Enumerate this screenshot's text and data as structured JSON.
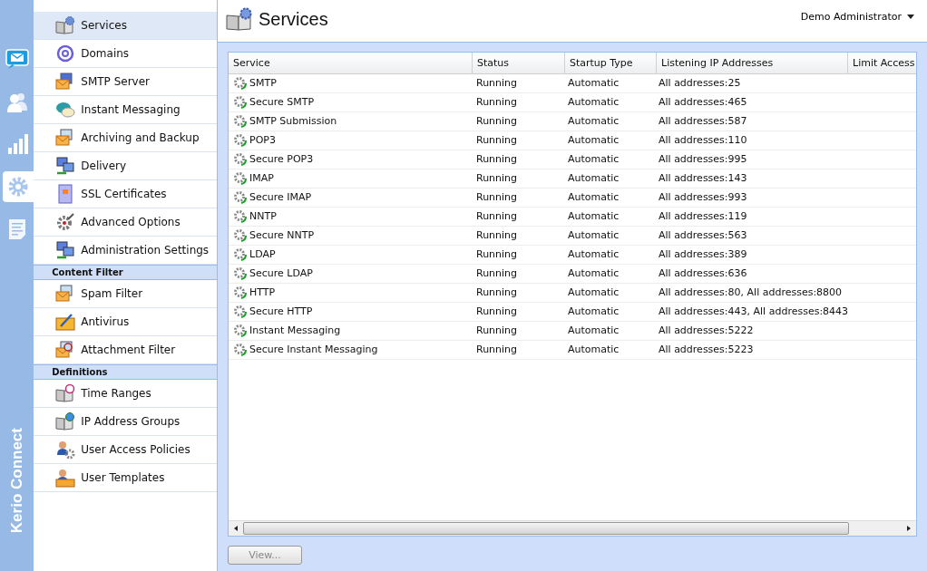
{
  "nav_rail": {
    "items": [
      {
        "selected": false
      },
      {
        "selected": false
      },
      {
        "selected": false
      },
      {
        "selected": true
      },
      {
        "selected": false
      }
    ],
    "brand": "Kerio Connect"
  },
  "sidebar": {
    "groups": [
      {
        "items": [
          {
            "label": "Services",
            "selected": true
          },
          {
            "label": "Domains",
            "selected": false
          },
          {
            "label": "SMTP Server",
            "selected": false
          },
          {
            "label": "Instant Messaging",
            "selected": false
          },
          {
            "label": "Archiving and Backup",
            "selected": false
          },
          {
            "label": "Delivery",
            "selected": false
          },
          {
            "label": "SSL Certificates",
            "selected": false
          },
          {
            "label": "Advanced Options",
            "selected": false
          },
          {
            "label": "Administration Settings",
            "selected": false
          }
        ]
      },
      {
        "heading": "Content Filter",
        "items": [
          {
            "label": "Spam Filter",
            "selected": false
          },
          {
            "label": "Antivirus",
            "selected": false
          },
          {
            "label": "Attachment Filter",
            "selected": false
          }
        ]
      },
      {
        "heading": "Definitions",
        "items": [
          {
            "label": "Time Ranges",
            "selected": false
          },
          {
            "label": "IP Address Groups",
            "selected": false
          },
          {
            "label": "User Access Policies",
            "selected": false
          },
          {
            "label": "User Templates",
            "selected": false
          }
        ]
      }
    ]
  },
  "header": {
    "title": "Services",
    "user": "Demo Administrator"
  },
  "table": {
    "columns": [
      "Service",
      "Status",
      "Startup Type",
      "Listening IP Addresses",
      "Limit Access"
    ],
    "rows": [
      {
        "service": "SMTP",
        "status": "Running",
        "startup_type": "Automatic",
        "addresses": "All addresses:25"
      },
      {
        "service": "Secure SMTP",
        "status": "Running",
        "startup_type": "Automatic",
        "addresses": "All addresses:465"
      },
      {
        "service": "SMTP Submission",
        "status": "Running",
        "startup_type": "Automatic",
        "addresses": "All addresses:587"
      },
      {
        "service": "POP3",
        "status": "Running",
        "startup_type": "Automatic",
        "addresses": "All addresses:110"
      },
      {
        "service": "Secure POP3",
        "status": "Running",
        "startup_type": "Automatic",
        "addresses": "All addresses:995"
      },
      {
        "service": "IMAP",
        "status": "Running",
        "startup_type": "Automatic",
        "addresses": "All addresses:143"
      },
      {
        "service": "Secure IMAP",
        "status": "Running",
        "startup_type": "Automatic",
        "addresses": "All addresses:993"
      },
      {
        "service": "NNTP",
        "status": "Running",
        "startup_type": "Automatic",
        "addresses": "All addresses:119"
      },
      {
        "service": "Secure NNTP",
        "status": "Running",
        "startup_type": "Automatic",
        "addresses": "All addresses:563"
      },
      {
        "service": "LDAP",
        "status": "Running",
        "startup_type": "Automatic",
        "addresses": "All addresses:389"
      },
      {
        "service": "Secure LDAP",
        "status": "Running",
        "startup_type": "Automatic",
        "addresses": "All addresses:636"
      },
      {
        "service": "HTTP",
        "status": "Running",
        "startup_type": "Automatic",
        "addresses": "All addresses:80, All addresses:8800"
      },
      {
        "service": "Secure HTTP",
        "status": "Running",
        "startup_type": "Automatic",
        "addresses": "All addresses:443, All addresses:8443"
      },
      {
        "service": "Instant Messaging",
        "status": "Running",
        "startup_type": "Automatic",
        "addresses": "All addresses:5222"
      },
      {
        "service": "Secure Instant Messaging",
        "status": "Running",
        "startup_type": "Automatic",
        "addresses": "All addresses:5223"
      }
    ]
  },
  "view_button": {
    "label": "View...",
    "disabled": true
  }
}
